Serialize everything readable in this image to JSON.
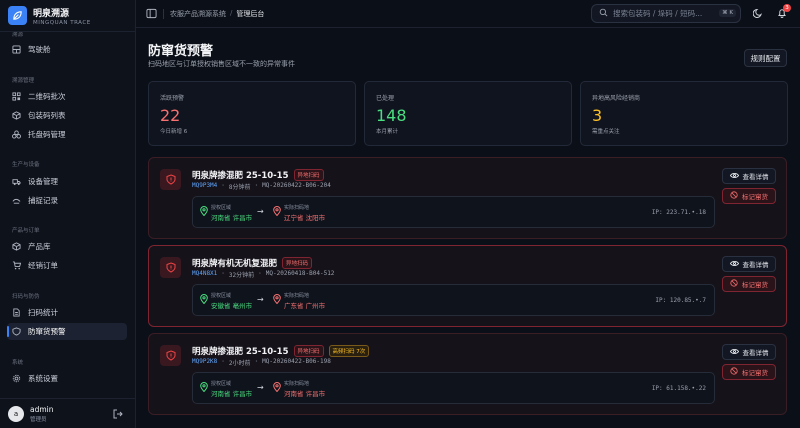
{
  "brand": {
    "name": "明泉溯源",
    "subtitle": "MINGQUAN TRACE",
    "logo_icon": "leaf-icon"
  },
  "sidebar": {
    "groups": [
      {
        "label": "溯源",
        "items": [
          {
            "label": "驾驶舱",
            "icon": "dashboard-icon"
          }
        ]
      },
      {
        "label": "溯源管理",
        "items": [
          {
            "label": "二维码批次",
            "icon": "qrcode-icon"
          },
          {
            "label": "包装码列表",
            "icon": "package-icon"
          },
          {
            "label": "托盘码管理",
            "icon": "pallet-icon"
          }
        ]
      },
      {
        "label": "生产与设备",
        "items": [
          {
            "label": "设备管理",
            "icon": "truck-icon"
          },
          {
            "label": "捕捉记录",
            "icon": "camera-icon"
          }
        ]
      },
      {
        "label": "产品与订单",
        "items": [
          {
            "label": "产品库",
            "icon": "box-icon"
          },
          {
            "label": "经销订单",
            "icon": "cart-icon"
          }
        ]
      },
      {
        "label": "扫码与防伪",
        "items": [
          {
            "label": "扫码统计",
            "icon": "file-icon"
          },
          {
            "label": "防窜货预警",
            "icon": "alert-icon",
            "active": true
          }
        ]
      },
      {
        "label": "系统",
        "items": [
          {
            "label": "系统设置",
            "icon": "gear-icon"
          }
        ]
      }
    ]
  },
  "user": {
    "avatar_letter": "a",
    "name": "admin",
    "role": "管理员"
  },
  "header": {
    "breadcrumb": [
      "农服产品溯源系统",
      "管理后台"
    ],
    "search_placeholder": "搜索包装码 / 垛码 / 短码...",
    "shortcut": "⌘ K",
    "notification_count": "3"
  },
  "page": {
    "title": "防窜货预警",
    "subtitle": "扫码地区与订单授权销售区域不一致的异常事件",
    "rules_button": "规则配置"
  },
  "stats": [
    {
      "label": "活跃预警",
      "value": "22",
      "sub": "今日新增 6",
      "color": "#f87171"
    },
    {
      "label": "已处理",
      "value": "148",
      "sub": "本月累计",
      "color": "#4ade80"
    },
    {
      "label": "异地高风险经销商",
      "value": "3",
      "sub": "需重点关注",
      "color": "#fbbf24"
    }
  ],
  "alerts": [
    {
      "product": "明泉牌掺混肥 25-10-15",
      "tags": [
        "异地扫码"
      ],
      "code": "MQ9P3M4",
      "time": "8分钟前",
      "order": "MQ-20260422-B06-204",
      "auth_label": "授权区域",
      "auth_region": "河南省 许昌市",
      "scan_label": "实际扫码地",
      "scan_region": "辽宁省 沈阳市",
      "ip": "IP: 223.71.•.18",
      "view_label": "查看详情",
      "mark_label": "标记窜货"
    },
    {
      "product": "明泉牌有机无机复混肥",
      "tags": [
        "异地扫码"
      ],
      "code": "MQ4N8X1",
      "time": "32分钟前",
      "order": "MQ-20260418-B04-512",
      "auth_label": "授权区域",
      "auth_region": "安徽省 亳州市",
      "scan_label": "实际扫码地",
      "scan_region": "广东省 广州市",
      "ip": "IP: 120.85.•.7",
      "view_label": "查看详情",
      "mark_label": "标记窜货"
    },
    {
      "product": "明泉牌掺混肥 25-10-15",
      "tags": [
        "异地扫码",
        "高频扫码 7次"
      ],
      "code": "MQ9P2K8",
      "time": "2小时前",
      "order": "MQ-20260422-B06-198",
      "auth_label": "授权区域",
      "auth_region": "河南省 许昌市",
      "scan_label": "实际扫码地",
      "scan_region": "河南省 许昌市",
      "ip": "IP: 61.158.•.22",
      "view_label": "查看详情",
      "mark_label": "标记窜货"
    }
  ]
}
